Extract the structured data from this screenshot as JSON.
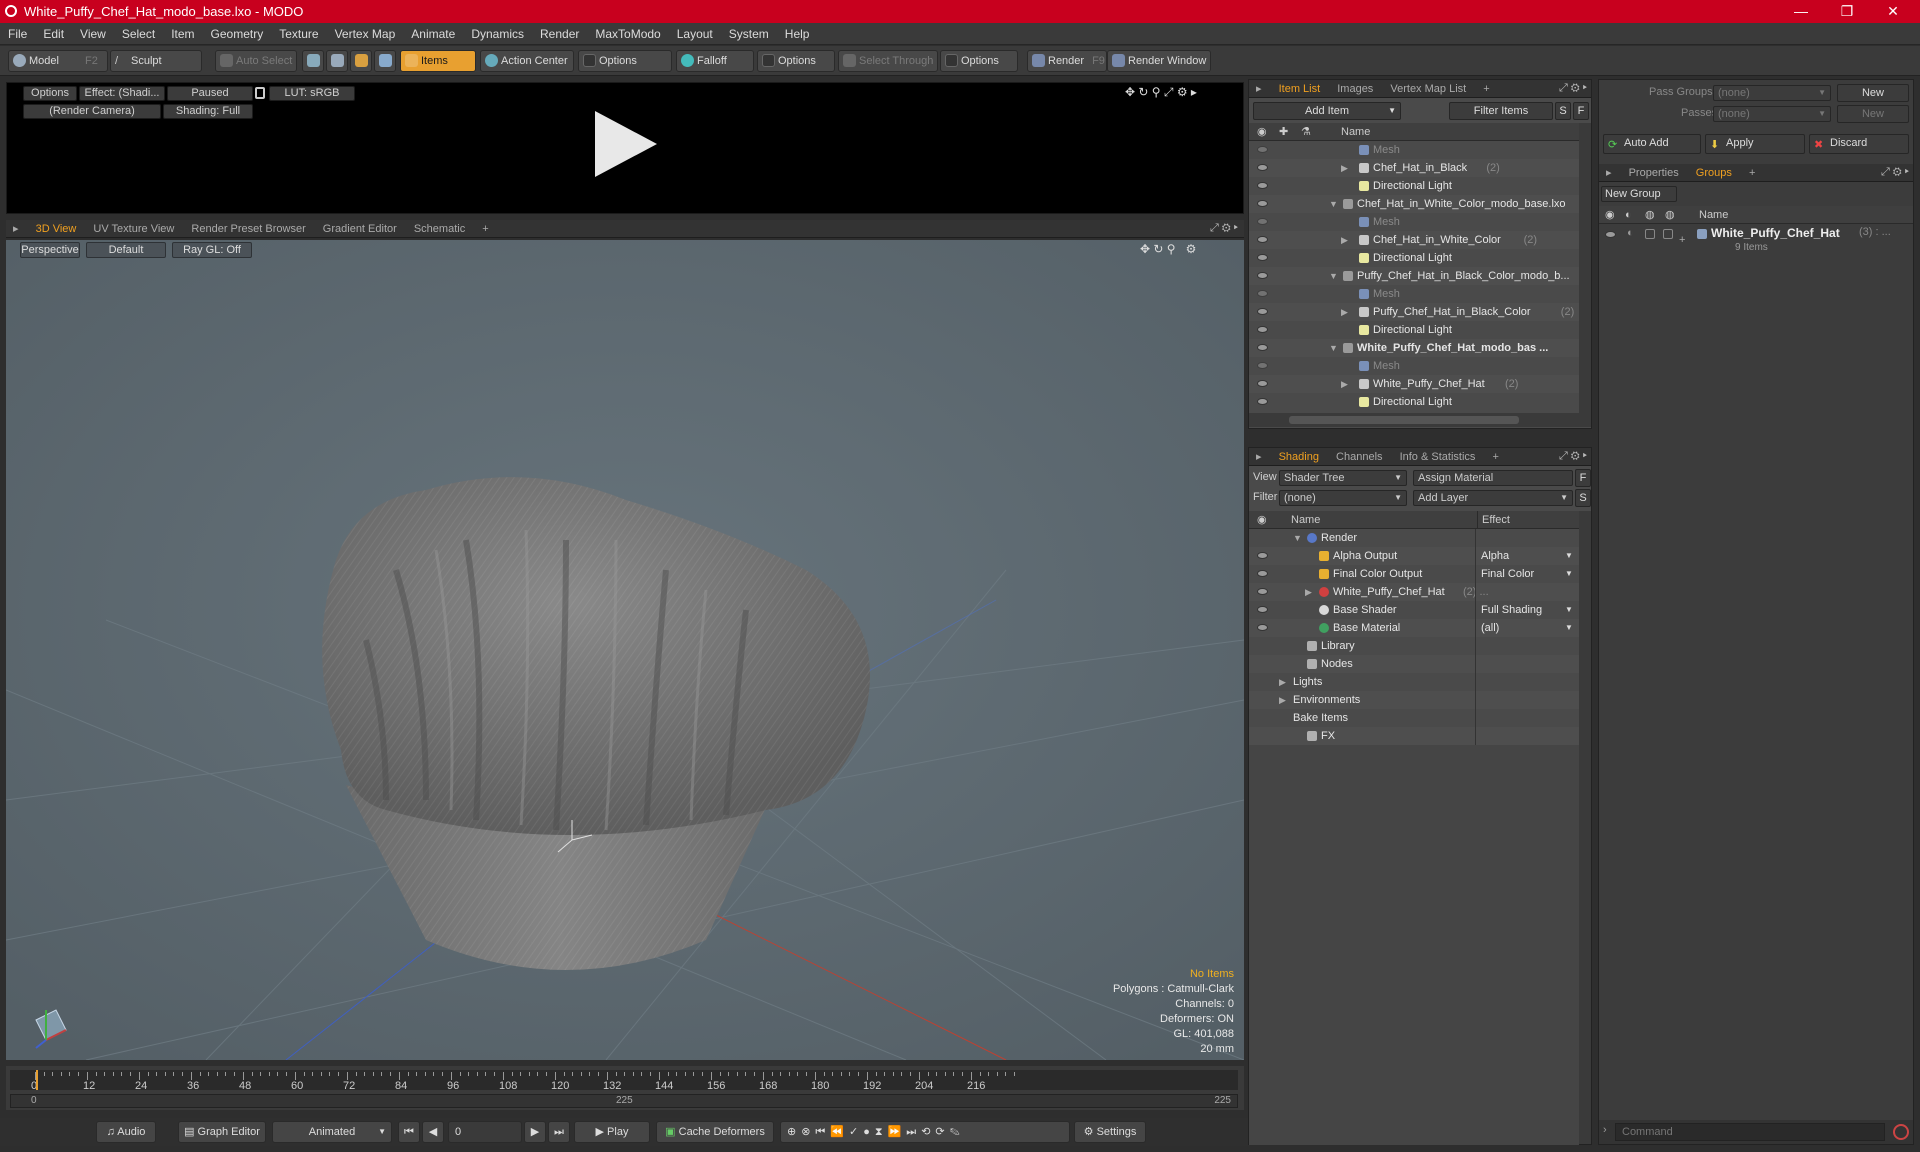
{
  "window": {
    "title": "White_Puffy_Chef_Hat_modo_base.lxo - MODO",
    "minimize": "—",
    "maximize": "❐",
    "close": "✕"
  },
  "menu": [
    "File",
    "Edit",
    "View",
    "Select",
    "Item",
    "Geometry",
    "Texture",
    "Vertex Map",
    "Animate",
    "Dynamics",
    "Render",
    "MaxToModo",
    "Layout",
    "System",
    "Help"
  ],
  "toolbar": {
    "model": "Model",
    "model_key": "F2",
    "sculpt": "Sculpt",
    "auto_select": "Auto Select",
    "items": "Items",
    "action_center": "Action Center",
    "options1": "Options",
    "falloff": "Falloff",
    "options2": "Options",
    "select_through": "Select Through",
    "options3": "Options",
    "render": "Render",
    "render_key": "F9",
    "render_window": "Render Window"
  },
  "preview": {
    "options": "Options",
    "effect": "Effect: (Shadi...",
    "paused": "Paused",
    "lut": "LUT: sRGB",
    "camera": "(Render Camera)",
    "shading": "Shading: Full"
  },
  "viewport_tabs": [
    {
      "label": "3D View",
      "active": true
    },
    {
      "label": "UV Texture View",
      "active": false
    },
    {
      "label": "Render Preset Browser",
      "active": false
    },
    {
      "label": "Gradient Editor",
      "active": false
    },
    {
      "label": "Schematic",
      "active": false
    }
  ],
  "viewport": {
    "perspective": "Perspective",
    "default": "Default",
    "raygl": "Ray GL: Off",
    "info_items": "No Items",
    "info_polys": "Polygons : Catmull-Clark",
    "info_channels": "Channels: 0",
    "info_deformers": "Deformers: ON",
    "info_gl": "GL: 401,088",
    "info_scale": "20 mm"
  },
  "timeline": {
    "ticks": [
      "0",
      "12",
      "24",
      "36",
      "48",
      "60",
      "72",
      "84",
      "96",
      "108",
      "120",
      "132",
      "144",
      "156",
      "168",
      "180",
      "192",
      "204",
      "216"
    ],
    "start": "0",
    "mid": "225",
    "end": "225"
  },
  "transport": {
    "audio": "Audio",
    "graph_editor": "Graph Editor",
    "animated": "Animated",
    "frame": "0",
    "play": "Play",
    "cache_deformers": "Cache Deformers",
    "settings": "Settings"
  },
  "item_list": {
    "tabs": [
      "Item List",
      "Images",
      "Vertex Map List"
    ],
    "add_item": "Add Item",
    "filter_items": "Filter Items",
    "s": "S",
    "f": "F",
    "col_name": "Name",
    "rows": [
      {
        "label": "Mesh",
        "type": "mesh",
        "indent": 2,
        "grey": true,
        "expand": ""
      },
      {
        "label": "Chef_Hat_in_Black",
        "count": "(2)",
        "type": "locator",
        "indent": 2,
        "expand": "▶"
      },
      {
        "label": "Directional Light",
        "type": "light",
        "indent": 2,
        "expand": ""
      },
      {
        "label": "Chef_Hat_in_White_Color_modo_base.lxo",
        "type": "scene",
        "indent": 1,
        "expand": "▼"
      },
      {
        "label": "Mesh",
        "type": "mesh",
        "indent": 2,
        "grey": true,
        "expand": ""
      },
      {
        "label": "Chef_Hat_in_White_Color",
        "count": "(2)",
        "type": "locator",
        "indent": 2,
        "expand": "▶"
      },
      {
        "label": "Directional Light",
        "type": "light",
        "indent": 2,
        "expand": ""
      },
      {
        "label": "Puffy_Chef_Hat_in_Black_Color_modo_b...",
        "type": "scene",
        "indent": 1,
        "expand": "▼"
      },
      {
        "label": "Mesh",
        "type": "mesh",
        "indent": 2,
        "grey": true,
        "expand": ""
      },
      {
        "label": "Puffy_Chef_Hat_in_Black_Color",
        "count": "(2)",
        "type": "locator",
        "indent": 2,
        "expand": "▶"
      },
      {
        "label": "Directional Light",
        "type": "light",
        "indent": 2,
        "expand": ""
      },
      {
        "label": "White_Puffy_Chef_Hat_modo_bas ...",
        "type": "scene",
        "indent": 1,
        "bold": true,
        "expand": "▼"
      },
      {
        "label": "Mesh",
        "type": "mesh",
        "indent": 2,
        "grey": true,
        "expand": ""
      },
      {
        "label": "White_Puffy_Chef_Hat",
        "count": "(2)",
        "type": "locator",
        "indent": 2,
        "expand": "▶"
      },
      {
        "label": "Directional Light",
        "type": "light",
        "indent": 2,
        "expand": ""
      }
    ]
  },
  "shading": {
    "tabs": [
      "Shading",
      "Channels",
      "Info & Statistics"
    ],
    "view_label": "View",
    "view_value": "Shader Tree",
    "assign_material": "Assign Material",
    "f": "F",
    "filter_label": "Filter",
    "filter_value": "(none)",
    "add_layer": "Add Layer",
    "s": "S",
    "col_name": "Name",
    "col_effect": "Effect",
    "rows": [
      {
        "label": "Render",
        "effect": "",
        "indent": 1,
        "expand": "▼",
        "eye": false,
        "type": "render"
      },
      {
        "label": "Alpha Output",
        "effect": "Alpha",
        "indent": 2,
        "expand": "",
        "eye": true,
        "type": "output"
      },
      {
        "label": "Final Color Output",
        "effect": "Final Color",
        "indent": 2,
        "expand": "",
        "eye": true,
        "type": "output"
      },
      {
        "label": "White_Puffy_Chef_Hat",
        "count": "(2) ...",
        "effect": "",
        "indent": 2,
        "expand": "▶",
        "eye": true,
        "type": "material"
      },
      {
        "label": "Base Shader",
        "effect": "Full Shading",
        "indent": 2,
        "expand": "",
        "eye": true,
        "type": "shader"
      },
      {
        "label": "Base Material",
        "effect": "(all)",
        "indent": 2,
        "expand": "",
        "eye": true,
        "type": "basemat"
      },
      {
        "label": "Library",
        "effect": "",
        "indent": 1,
        "expand": "",
        "eye": false,
        "type": "folder"
      },
      {
        "label": "Nodes",
        "effect": "",
        "indent": 1,
        "expand": "",
        "eye": false,
        "type": "folder"
      },
      {
        "label": "Lights",
        "effect": "",
        "indent": 0,
        "expand": "▶",
        "eye": false,
        "type": "none"
      },
      {
        "label": "Environments",
        "effect": "",
        "indent": 0,
        "expand": "▶",
        "eye": false,
        "type": "none"
      },
      {
        "label": "Bake Items",
        "effect": "",
        "indent": 0,
        "expand": "",
        "eye": false,
        "type": "none"
      },
      {
        "label": "FX",
        "effect": "",
        "indent": 1,
        "expand": "",
        "eye": false,
        "type": "fx"
      }
    ]
  },
  "groups": {
    "pass_groups_label": "Pass Groups",
    "pass_groups_value": "(none)",
    "new": "New",
    "passes_label": "Passes",
    "passes_value": "(none)",
    "new2": "New",
    "auto_add": "Auto Add",
    "apply": "Apply",
    "discard": "Discard",
    "tabs": [
      "Properties",
      "Groups"
    ],
    "new_group": "New Group",
    "col_name": "Name",
    "group_name": "White_Puffy_Chef_Hat",
    "group_count": "(3) : ...",
    "group_items": "9 Items"
  },
  "command": {
    "placeholder": "Command"
  }
}
